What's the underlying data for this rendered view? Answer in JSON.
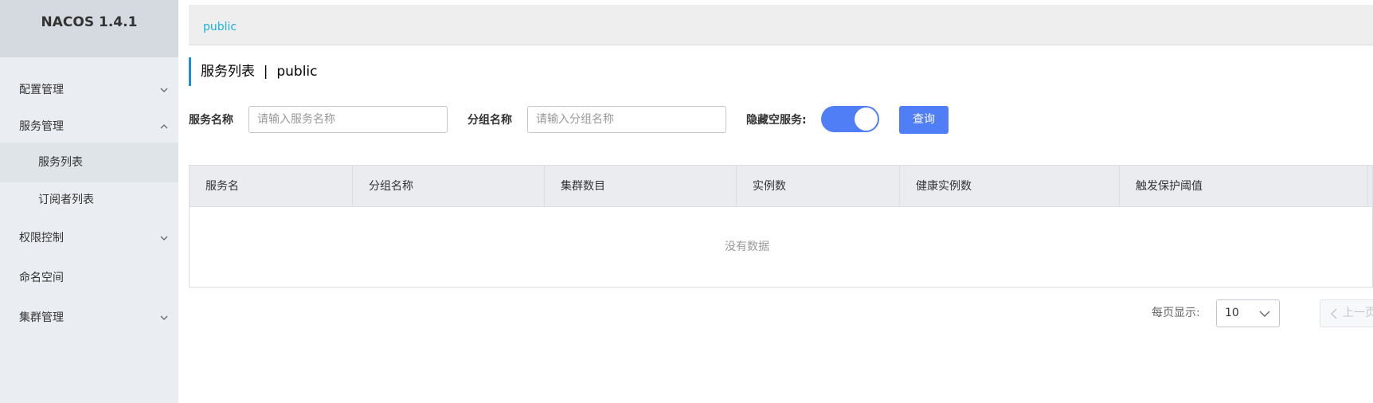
{
  "brand": {
    "name": "NACOS 1.4.1"
  },
  "sidebar": {
    "items": [
      {
        "label": "配置管理"
      },
      {
        "label": "服务管理"
      },
      {
        "label": "服务列表"
      },
      {
        "label": "订阅者列表"
      },
      {
        "label": "权限控制"
      },
      {
        "label": "命名空间"
      },
      {
        "label": "集群管理"
      }
    ]
  },
  "topbar": {
    "namespace": "public"
  },
  "page": {
    "title": "服务列表  |  public"
  },
  "filters": {
    "service_name_label": "服务名称",
    "service_name_placeholder": "请输入服务名称",
    "group_name_label": "分组名称",
    "group_name_placeholder": "请输入分组名称",
    "hide_empty_label": "隐藏空服务:",
    "hide_empty_on": true,
    "query_label": "查询"
  },
  "table": {
    "columns": [
      "服务名",
      "分组名称",
      "集群数目",
      "实例数",
      "健康实例数",
      "触发保护阈值"
    ],
    "rows": [],
    "empty_text": "没有数据"
  },
  "pagination": {
    "page_size_label": "每页显示:",
    "page_size": "10",
    "prev_label": "上一页"
  },
  "colors": {
    "accent": "#4f7ef6",
    "link": "#1ab3d9",
    "sidebar_bg": "#eaedf1"
  }
}
